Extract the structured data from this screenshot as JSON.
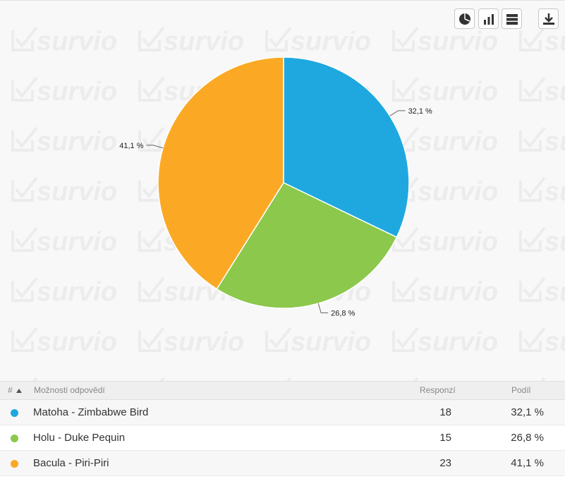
{
  "toolbar": {
    "buttons": [
      {
        "name": "pie-chart-icon",
        "icon": "pie-chart-icon"
      },
      {
        "name": "bar-chart-icon",
        "icon": "bar-chart-icon"
      },
      {
        "name": "table-view-icon",
        "icon": "table-view-icon"
      },
      {
        "name": "download-icon",
        "icon": "download-icon"
      }
    ]
  },
  "watermark": {
    "text": "survio"
  },
  "chart_data": {
    "type": "pie",
    "categories": [
      "Matoha - Zimbabwe Bird",
      "Holu - Duke Pequin",
      "Bacula - Piri-Piri"
    ],
    "values": [
      18,
      15,
      23
    ],
    "labels": [
      "32,1 %",
      "26,8 %",
      "41,1 %"
    ],
    "colors": [
      "#1fa8e0",
      "#8cc84b",
      "#fba925"
    ],
    "start_angle": "12 o'clock, clockwise",
    "legend": "none"
  },
  "table": {
    "headers": {
      "index": "#",
      "options": "Možnosti odpovědí",
      "responses": "Responzí",
      "share": "Podíl"
    },
    "rows": [
      {
        "label": "Matoha - Zimbabwe Bird",
        "count": "18",
        "share": "32,1 %",
        "color": "#1fa8e0"
      },
      {
        "label": "Holu - Duke Pequin",
        "count": "15",
        "share": "26,8 %",
        "color": "#8cc84b"
      },
      {
        "label": "Bacula - Piri-Piri",
        "count": "23",
        "share": "41,1 %",
        "color": "#fba925"
      }
    ]
  }
}
